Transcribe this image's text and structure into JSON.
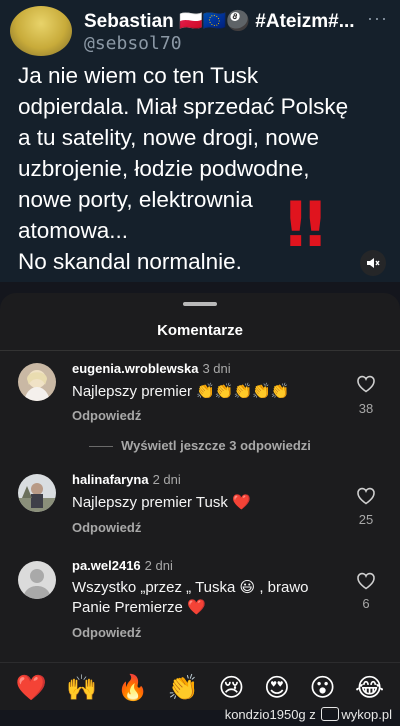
{
  "tweet": {
    "name": "Sebastian 🇵🇱🇪🇺🎱 #Ateizm#...",
    "handle": "@sebsol70",
    "more": "···",
    "lines": [
      "Ja nie wiem co ten Tusk",
      "odpierdala. Miał sprzedać Polskę",
      "a tu satelity, nowe drogi, nowe",
      "uzbrojenie, łodzie podwodne,",
      "nowe porty, elektrownia",
      "atomowa...",
      "No skandal normalnie."
    ],
    "overlay": "‼"
  },
  "sheet": {
    "title": "Komentarze",
    "reply_label": "Odpowiedź",
    "view_more": "Wyświetl jeszcze 3 odpowiedzi"
  },
  "comments": [
    {
      "user": "eugenia.wroblewska",
      "time": "3 dni",
      "text": "Najlepszy  premier 👏👏👏👏👏",
      "likes": "38"
    },
    {
      "user": "halinafaryna",
      "time": "2 dni",
      "text": "Najlepszy premier Tusk ❤️",
      "likes": "25"
    },
    {
      "user": "pa.wel2416",
      "time": "2 dni",
      "text_line1": "Wszystko „przez „ Tuska 😃 , brawo",
      "text_line2": "Panie Premierze ❤️",
      "likes": "6"
    }
  ],
  "reactions": [
    "❤️",
    "🙌",
    "🔥",
    "👏",
    "😢",
    "😍",
    "😮",
    "😂"
  ],
  "watermark": {
    "user": "kondzio1950g",
    "sep": "z",
    "site": "wykop.pl"
  },
  "colors": {
    "accent_red": "#e0141e",
    "sheet_bg": "#1c1c1e",
    "muted_text": "#a8a8a8"
  }
}
